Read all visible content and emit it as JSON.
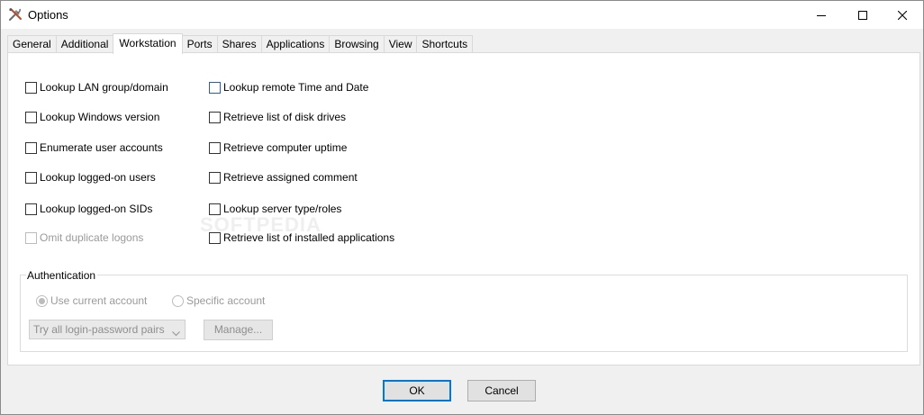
{
  "window": {
    "title": "Options",
    "controls": {
      "minimize": "minimize-icon",
      "maximize": "maximize-icon",
      "close": "close-icon"
    }
  },
  "tabs": [
    {
      "label": "General",
      "active": false
    },
    {
      "label": "Additional",
      "active": false
    },
    {
      "label": "Workstation",
      "active": true
    },
    {
      "label": "Ports",
      "active": false
    },
    {
      "label": "Shares",
      "active": false
    },
    {
      "label": "Applications",
      "active": false
    },
    {
      "label": "Browsing",
      "active": false
    },
    {
      "label": "View",
      "active": false
    },
    {
      "label": "Shortcuts",
      "active": false
    }
  ],
  "workstation": {
    "left_options": [
      {
        "label": "Lookup LAN group/domain",
        "checked": false,
        "enabled": true
      },
      {
        "label": "Lookup Windows version",
        "checked": false,
        "enabled": true
      },
      {
        "label": "Enumerate user accounts",
        "checked": false,
        "enabled": true
      },
      {
        "label": "Lookup logged-on users",
        "checked": false,
        "enabled": true
      },
      {
        "label": "Lookup logged-on SIDs",
        "checked": false,
        "enabled": true
      },
      {
        "label": "Omit duplicate logons",
        "checked": false,
        "enabled": false
      }
    ],
    "right_options": [
      {
        "label": "Lookup remote Time and Date",
        "checked": false,
        "enabled": true
      },
      {
        "label": "Retrieve list of disk drives",
        "checked": false,
        "enabled": true
      },
      {
        "label": "Retrieve computer uptime",
        "checked": false,
        "enabled": true
      },
      {
        "label": "Retrieve assigned comment",
        "checked": false,
        "enabled": true
      },
      {
        "label": "Lookup server type/roles",
        "checked": false,
        "enabled": true
      },
      {
        "label": "Retrieve list of installed applications",
        "checked": false,
        "enabled": true
      }
    ]
  },
  "authentication": {
    "title": "Authentication",
    "radio_current": "Use current account",
    "radio_specific": "Specific account",
    "selected": "current",
    "credentials_select": "Try all login-password pairs",
    "manage_button": "Manage..."
  },
  "watermark": "SOFTPEDIA",
  "buttons": {
    "ok": "OK",
    "cancel": "Cancel"
  },
  "colors": {
    "accent": "#0078d7",
    "disabled_text": "#9a9a9a",
    "window_bg": "#f0f0f0"
  }
}
